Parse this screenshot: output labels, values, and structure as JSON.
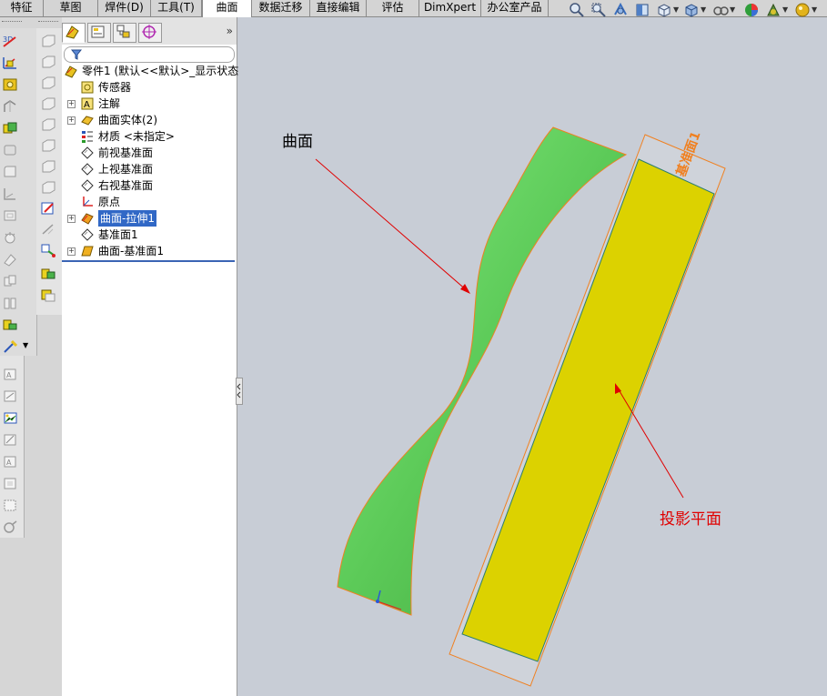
{
  "tabs": [
    {
      "label": "特征",
      "active": false
    },
    {
      "label": "草图",
      "active": false
    },
    {
      "label": "焊件(D)",
      "active": false
    },
    {
      "label": "工具(T)",
      "active": false
    },
    {
      "label": "曲面",
      "active": true
    },
    {
      "label": "数据迁移",
      "active": false
    },
    {
      "label": "直接编辑",
      "active": false
    },
    {
      "label": "评估",
      "active": false
    },
    {
      "label": "DimXpert",
      "active": false
    },
    {
      "label": "办公室产品",
      "active": false
    }
  ],
  "hud_icons": [
    "zoom-to-fit-icon",
    "zoom-to-area-icon",
    "previous-view-icon",
    "section-view-icon",
    "view-orientation-icon",
    "display-style-icon",
    "hide-show-items-icon",
    "edit-appearance-icon",
    "apply-scene-icon",
    "view-settings-icon"
  ],
  "feature_manager": {
    "tab_icons": [
      "feature-manager-tab-icon",
      "property-manager-tab-icon",
      "configuration-manager-tab-icon",
      "dimxpert-manager-tab-icon"
    ],
    "more_symbol": "»",
    "tree": [
      {
        "label": "零件1  (默认<<默认>_显示状态",
        "icon": "part-icon",
        "level": 0,
        "expander": false,
        "selected": false
      },
      {
        "label": "传感器",
        "icon": "sensors-icon",
        "level": 1,
        "expander": false,
        "selected": false
      },
      {
        "label": "注解",
        "icon": "annotations-icon",
        "level": 1,
        "expander": true,
        "selected": false
      },
      {
        "label": "曲面实体(2)",
        "icon": "surface-bodies-icon",
        "level": 1,
        "expander": true,
        "selected": false
      },
      {
        "label": "材质 <未指定>",
        "icon": "material-icon",
        "level": 1,
        "expander": false,
        "selected": false
      },
      {
        "label": "前视基准面",
        "icon": "plane-icon",
        "level": 1,
        "expander": false,
        "selected": false
      },
      {
        "label": "上视基准面",
        "icon": "plane-icon",
        "level": 1,
        "expander": false,
        "selected": false
      },
      {
        "label": "右视基准面",
        "icon": "plane-icon",
        "level": 1,
        "expander": false,
        "selected": false
      },
      {
        "label": "原点",
        "icon": "origin-icon",
        "level": 1,
        "expander": false,
        "selected": false
      },
      {
        "label": "曲面-拉伸1",
        "icon": "surface-extrude-icon",
        "level": 1,
        "expander": true,
        "selected": true
      },
      {
        "label": "基准面1",
        "icon": "plane-icon",
        "level": 1,
        "expander": false,
        "selected": false
      },
      {
        "label": "曲面-基准面1",
        "icon": "planar-surface-icon",
        "level": 1,
        "expander": true,
        "selected": false
      }
    ]
  },
  "viewport": {
    "annotations": {
      "surface_label": "曲面",
      "projection_plane_label": "投影平面",
      "plane_tag": "基准面1"
    },
    "colors": {
      "background": "#c8cdd6",
      "surface_green": "#6fd86a",
      "plane_yellow": "#dcd200",
      "edge_orange": "#f08020",
      "annotation_red": "#e00000"
    }
  }
}
